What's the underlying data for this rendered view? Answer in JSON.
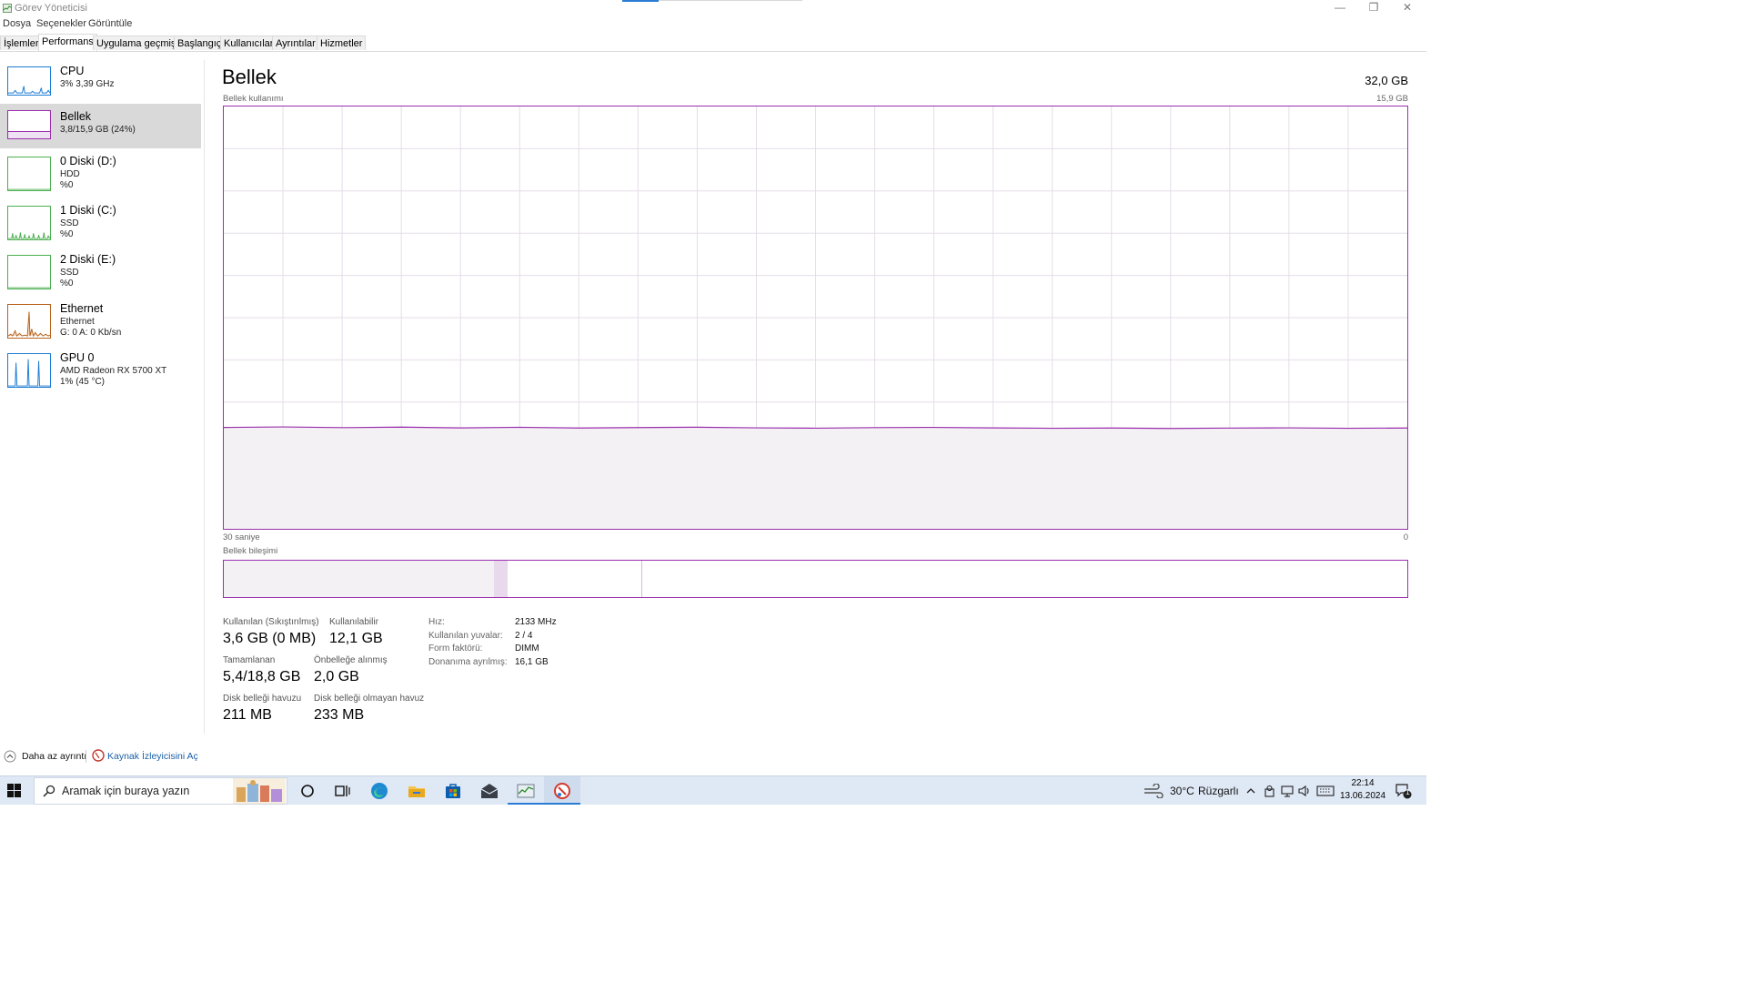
{
  "window": {
    "title": "Görev Yöneticisi",
    "minimize_glyph": "—",
    "restore_glyph": "❐",
    "close_glyph": "✕"
  },
  "menu": [
    "Dosya",
    "Seçenekler",
    "Görüntüle"
  ],
  "tabs": [
    {
      "label": "İşlemler",
      "active": false
    },
    {
      "label": "Performans",
      "active": true
    },
    {
      "label": "Uygulama geçmişi",
      "active": false
    },
    {
      "label": "Başlangıç",
      "active": false
    },
    {
      "label": "Kullanıcılar",
      "active": false
    },
    {
      "label": "Ayrıntılar",
      "active": false
    },
    {
      "label": "Hizmetler",
      "active": false
    }
  ],
  "sidebar": {
    "items": [
      {
        "name": "CPU",
        "line1": "3% 3,39 GHz",
        "line2": "",
        "color": "#1c7bd4",
        "selected": false
      },
      {
        "name": "Bellek",
        "line1": "3,8/15,9 GB (24%)",
        "line2": "",
        "color": "#9b2fae",
        "selected": true
      },
      {
        "name": "0 Diski (D:)",
        "line1": "HDD",
        "line2": "%0",
        "color": "#4caf50",
        "selected": false
      },
      {
        "name": "1 Diski (C:)",
        "line1": "SSD",
        "line2": "%0",
        "color": "#4caf50",
        "selected": false
      },
      {
        "name": "2 Diski (E:)",
        "line1": "SSD",
        "line2": "%0",
        "color": "#4caf50",
        "selected": false
      },
      {
        "name": "Ethernet",
        "line1": "Ethernet",
        "line2": "G: 0 A: 0 Kb/sn",
        "color": "#b8621c",
        "selected": false
      },
      {
        "name": "GPU 0",
        "line1": "AMD Radeon RX 5700 XT",
        "line2": "1% (45 °C)",
        "color": "#1c7bd4",
        "selected": false
      }
    ]
  },
  "main": {
    "title": "Bellek",
    "total": "32,0 GB",
    "usage_label": "Bellek kullanımı",
    "usage_max": "15,9 GB",
    "time_left": "30 saniye",
    "time_right": "0",
    "composition_label": "Bellek bileşimi",
    "usage_fraction": 0.24,
    "composition": {
      "in_use": 0.228,
      "modified": 0.012,
      "standby": 0.113,
      "free": 0.647
    },
    "stats": [
      {
        "label": "Kullanılan (Sıkıştırılmış)",
        "value": "3,6 GB (0 MB)"
      },
      {
        "label": "Kullanılabilir",
        "value": "12,1 GB"
      },
      {
        "label": "Tamamlanan",
        "value": "5,4/18,8 GB"
      },
      {
        "label": "Önbelleğe alınmış",
        "value": "2,0 GB"
      },
      {
        "label": "Disk belleği havuzu",
        "value": "211 MB"
      },
      {
        "label": "Disk belleği olmayan havuz",
        "value": "233 MB"
      }
    ],
    "specs": [
      {
        "label": "Hız:",
        "value": "2133 MHz"
      },
      {
        "label": "Kullanılan yuvalar:",
        "value": "2 / 4"
      },
      {
        "label": "Form faktörü:",
        "value": "DIMM"
      },
      {
        "label": "Donanıma ayrılmış:",
        "value": "16,1 GB"
      }
    ]
  },
  "footer": {
    "less_details": "Daha az ayrıntı",
    "resource_monitor": "Kaynak İzleyicisini Aç"
  },
  "taskbar": {
    "search_placeholder": "Aramak için buraya yazın",
    "weather": "30°C",
    "weather_desc": "Rüzgarlı",
    "time": "22:14",
    "date": "13.06.2024",
    "notification_count": "1"
  },
  "colors": {
    "memory": "#9b2fae",
    "cpu": "#1c7bd4",
    "disk": "#4caf50",
    "ethernet": "#b8621c"
  }
}
